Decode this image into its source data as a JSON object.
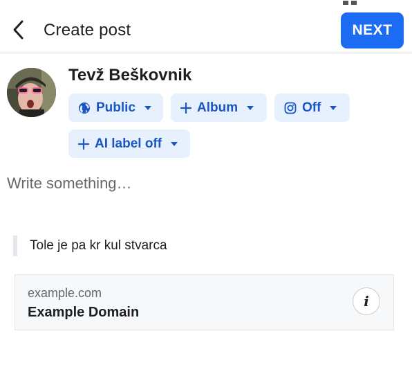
{
  "header": {
    "title": "Create post",
    "next_label": "NEXT",
    "back_icon": "chevron-left-icon"
  },
  "user": {
    "name": "Tevž Beškovnik"
  },
  "audience_chips": [
    {
      "label": "Public",
      "icon": "globe-icon"
    },
    {
      "label": "Album",
      "icon": "plus-icon"
    },
    {
      "label": "Off",
      "icon": "instagram-icon"
    },
    {
      "label": "AI label off",
      "icon": "plus-icon"
    }
  ],
  "composer": {
    "placeholder": "Write something…"
  },
  "shared_text": "Tole je pa kr kul stvarca",
  "link_preview": {
    "domain": "example.com",
    "title": "Example Domain",
    "info_icon": "info-icon"
  },
  "colors": {
    "accent": "#1b6cf2",
    "chip_bg": "#e7f0fd",
    "chip_text": "#1a56c4"
  }
}
